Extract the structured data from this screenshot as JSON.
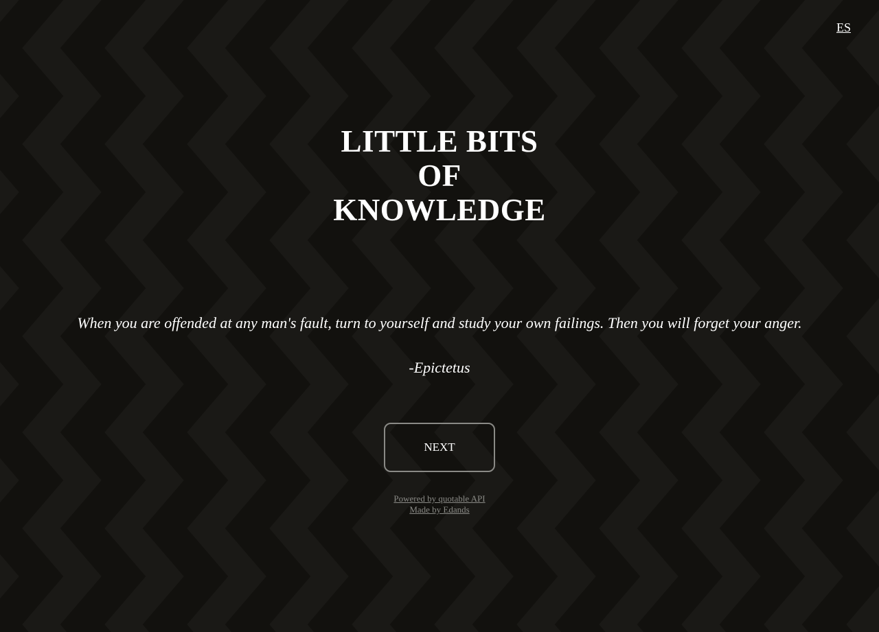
{
  "header": {
    "lang_toggle": "ES"
  },
  "title": {
    "lines": [
      "LITTLE BITS",
      "OF",
      "KNOWLEDGE"
    ]
  },
  "quote": {
    "text": "When you are offended at any man's fault, turn to yourself and study your own failings. Then you will forget your anger.",
    "author": "-Epictetus"
  },
  "actions": {
    "next_label": "NEXT"
  },
  "footer": {
    "powered_by": "Powered by quotable API",
    "made_by": "Made by Edands"
  },
  "theme": {
    "background": "#12110e",
    "chevron": "#1a1916",
    "text": "#ffffff",
    "muted": "#8a8a86"
  }
}
